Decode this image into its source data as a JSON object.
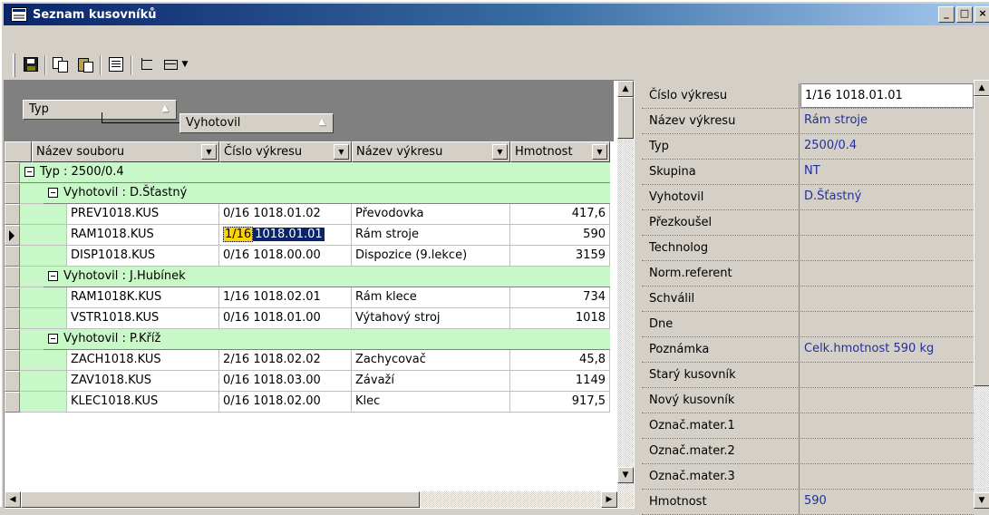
{
  "window": {
    "title": "Seznam kusovníků",
    "caption_buttons": [
      "_",
      "□",
      "×"
    ]
  },
  "toolbar": {
    "icons": [
      "save-icon",
      "copy-icon",
      "paste-icon",
      "properties-icon",
      "tree-view-icon",
      "list-view-icon"
    ],
    "dropdown_glyph": "▼"
  },
  "grid": {
    "group_chips": [
      {
        "label": "Typ",
        "arrow": "▲"
      },
      {
        "label": "Vyhotovil",
        "arrow": "▲"
      }
    ],
    "columns": [
      {
        "label": "Název souboru",
        "dropdown": "▼"
      },
      {
        "label": "Číslo výkresu",
        "dropdown": "▼"
      },
      {
        "label": "Název výkresu",
        "dropdown": "▼"
      },
      {
        "label": "Hmotnost",
        "dropdown": "▼"
      }
    ],
    "rows": [
      {
        "kind": "group1",
        "text": "Typ : 2500/0.4"
      },
      {
        "kind": "group2",
        "text": "Vyhotovil : D.Šťastný"
      },
      {
        "kind": "data",
        "file": "PREV1018.KUS",
        "num": "0/16 1018.01.02",
        "name": "Převodovka",
        "weight": "417,6"
      },
      {
        "kind": "data",
        "file": "RAM1018.KUS",
        "num_sel": "1/16",
        "num_rest": "1018.01.01",
        "name": "Rám stroje",
        "weight": "590",
        "current": true
      },
      {
        "kind": "data",
        "file": "DISP1018.KUS",
        "num": "0/16 1018.00.00",
        "name": "Dispozice (9.lekce)",
        "weight": "3159"
      },
      {
        "kind": "group2",
        "text": "Vyhotovil : J.Hubínek"
      },
      {
        "kind": "data",
        "file": "RAM1018K.KUS",
        "num": "1/16 1018.02.01",
        "name": "Rám klece",
        "weight": "734"
      },
      {
        "kind": "data",
        "file": "VSTR1018.KUS",
        "num": "0/16 1018.01.00",
        "name": "Výtahový stroj",
        "weight": "1018"
      },
      {
        "kind": "group2",
        "text": "Vyhotovil : P.Kříž"
      },
      {
        "kind": "data",
        "file": "ZACH1018.KUS",
        "num": "2/16 1018.02.02",
        "name": "Zachycovač",
        "weight": "45,8"
      },
      {
        "kind": "data",
        "file": "ZAV1018.KUS",
        "num": "0/16 1018.03.00",
        "name": "Závaží",
        "weight": "1149"
      },
      {
        "kind": "data",
        "file": "KLEC1018.KUS",
        "num": "0/16 1018.02.00",
        "name": "Klec",
        "weight": "917,5"
      }
    ],
    "scroll": {
      "up": "▲",
      "down": "▼",
      "left": "◀",
      "right": "▶"
    }
  },
  "properties": {
    "rows": [
      {
        "label": "Číslo výkresu",
        "value": "1/16 1018.01.01"
      },
      {
        "label": "Název výkresu",
        "value": "Rám stroje"
      },
      {
        "label": "Typ",
        "value": "2500/0.4"
      },
      {
        "label": "Skupina",
        "value": "NT"
      },
      {
        "label": "Vyhotovil",
        "value": "D.Šťastný"
      },
      {
        "label": "Přezkoušel",
        "value": ""
      },
      {
        "label": "Technolog",
        "value": ""
      },
      {
        "label": "Norm.referent",
        "value": ""
      },
      {
        "label": "Schválil",
        "value": ""
      },
      {
        "label": "Dne",
        "value": ""
      },
      {
        "label": "Poznámka",
        "value": "Celk.hmotnost 590 kg"
      },
      {
        "label": "Starý kusovník",
        "value": ""
      },
      {
        "label": "Nový kusovník",
        "value": ""
      },
      {
        "label": "Označ.mater.1",
        "value": ""
      },
      {
        "label": "Označ.mater.2",
        "value": ""
      },
      {
        "label": "Označ.mater.3",
        "value": ""
      },
      {
        "label": "Hmotnost",
        "value": "590"
      }
    ],
    "scroll": {
      "up": "▲",
      "down": "▼"
    }
  },
  "colors": {
    "group_row": "#c8f7c8",
    "value_text": "#1f2fa0",
    "selection": "#0a246a",
    "highlight": "#ffd400"
  }
}
